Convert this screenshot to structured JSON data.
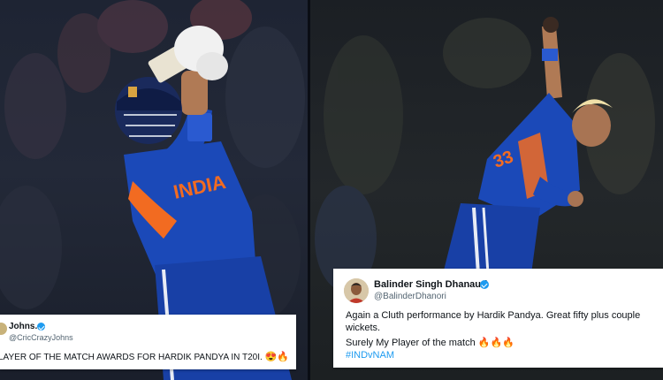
{
  "left_photo": {
    "jersey_text": "INDIA"
  },
  "right_photo": {
    "jersey_number": "33"
  },
  "tweets": [
    {
      "name": "Johns.",
      "handle": "@CricCrazyJohns",
      "text": "LAYER OF THE MATCH AWARDS FOR HARDIK PANDYA IN T20I.",
      "emoji": "😍🔥"
    },
    {
      "name": "Balinder Singh Dhanauri",
      "handle": "@BalinderDhanori",
      "line1": "Again a Cluth performance by Hardik Pandya. Great fifty plus couple",
      "line2": "wickets.",
      "line3": "Surely My Player of the match",
      "emoji": "🔥🔥🔥",
      "hashtag": "#INDvNAM"
    }
  ],
  "colors": {
    "jersey_blue": "#1b49b8",
    "jersey_orange": "#f26b21",
    "verified_blue": "#1d9bf0",
    "hashtag_blue": "#1d9bf0"
  }
}
